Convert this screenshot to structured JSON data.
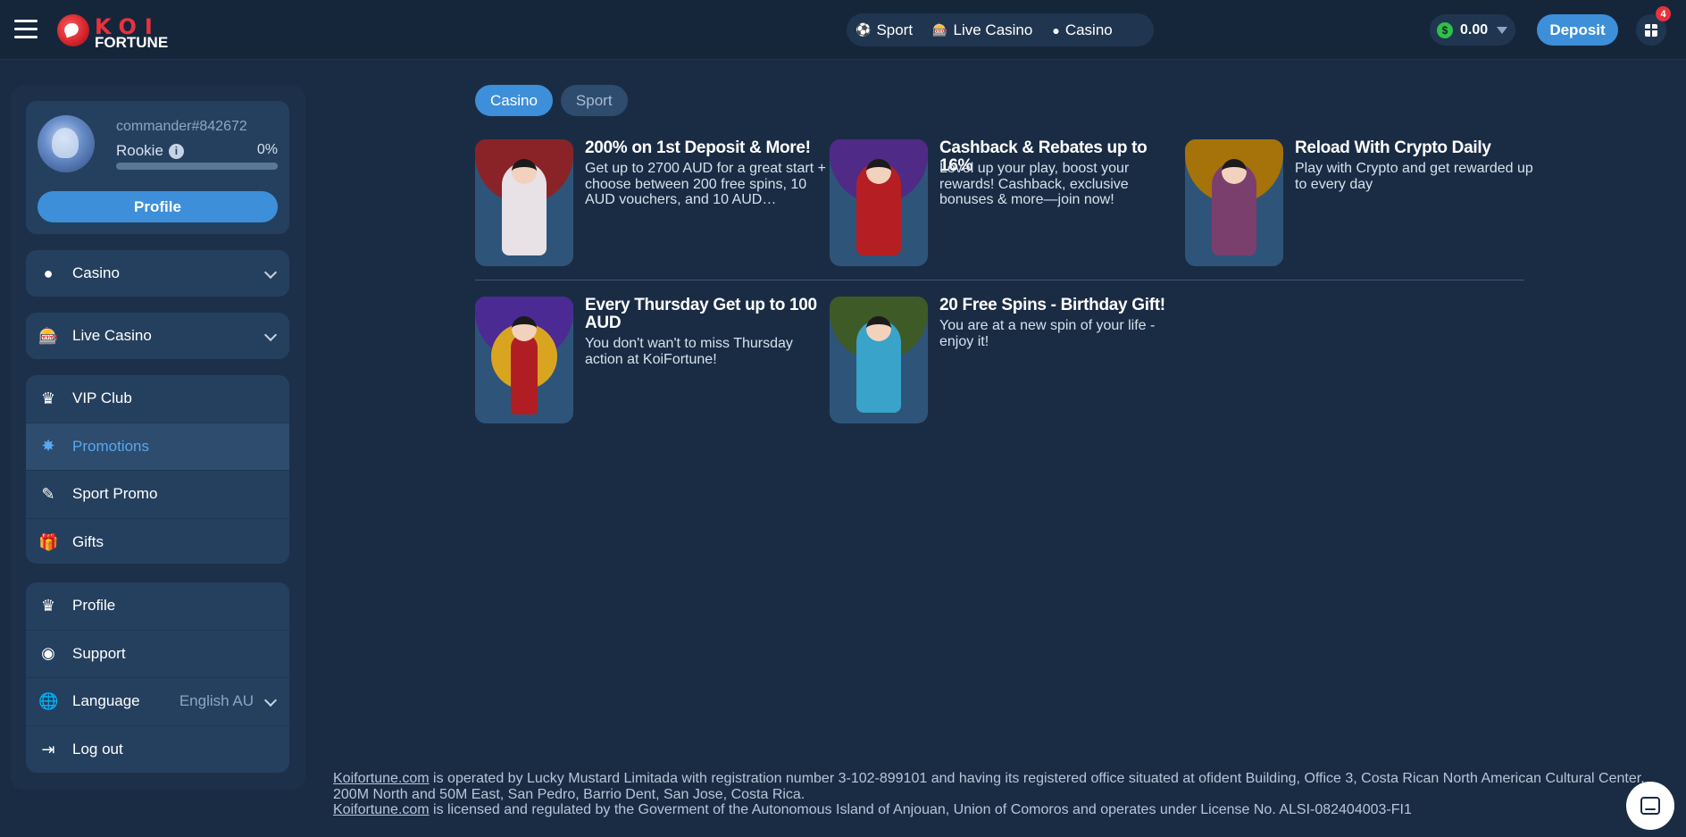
{
  "header": {
    "menu_icon": "hamburger-icon",
    "logo_top": "KOI",
    "logo_bottom": "FORTUNE",
    "nav": [
      {
        "label": "Sport",
        "icon": "soccer-ball-icon"
      },
      {
        "label": "Live Casino",
        "icon": "slot-machine-icon"
      },
      {
        "label": "Casino",
        "icon": "chip-icon"
      }
    ],
    "balance": "0.00",
    "currency_symbol": "$",
    "deposit_label": "Deposit",
    "gift_badge": "4"
  },
  "sidebar": {
    "profile": {
      "username": "commander#842672",
      "rank": "Rookie",
      "progress_pct": "0%",
      "progress_value": 0,
      "profile_button": "Profile"
    },
    "dropdowns": [
      {
        "label": "Casino",
        "icon": "chip-icon"
      },
      {
        "label": "Live Casino",
        "icon": "slot-machine-icon"
      }
    ],
    "menu": [
      {
        "label": "VIP Club",
        "icon": "crown-icon"
      },
      {
        "label": "Promotions",
        "icon": "star-burst-icon",
        "active": true
      },
      {
        "label": "Sport Promo",
        "icon": "ticket-icon"
      },
      {
        "label": "Gifts",
        "icon": "gift-icon"
      }
    ],
    "menu2": [
      {
        "label": "Profile",
        "icon": "crown-icon"
      },
      {
        "label": "Support",
        "icon": "support-icon"
      },
      {
        "label": "Language",
        "icon": "globe-icon",
        "value": "English AU"
      },
      {
        "label": "Log out",
        "icon": "logout-icon"
      }
    ]
  },
  "tabs": [
    {
      "label": "Casino",
      "active": true
    },
    {
      "label": "Sport",
      "active": false
    }
  ],
  "promotions": [
    {
      "title": "200% on 1st Deposit & More!",
      "description": "Get up to 2700 AUD for a great start + choose between 200 free spins, 10 AUD vouchers, and 10 AUD…",
      "color": "#8a2327"
    },
    {
      "title": "Cashback & Rebates up to 16%",
      "description": "Level up your play, boost your rewards! Cashback, exclusive bonuses & more—join now!",
      "color": "#4f2a86"
    },
    {
      "title": "Reload With Crypto Daily",
      "description": "Play with Crypto and get rewarded up to every day",
      "color": "#a6720a"
    },
    {
      "title": "Every Thursday Get up to 100 AUD",
      "description": "You don't wan't to miss Thursday action at KoiFortune!",
      "color": "#4c2a93"
    },
    {
      "title": "20 Free Spins - Birthday Gift!",
      "description": "You are at a new spin of your life - enjoy it!",
      "color": "#3e5a26"
    }
  ],
  "footer": {
    "link": "Koifortune.com",
    "line1": " is operated by Lucky Mustard Limitada with registration number 3-102-899101 and having its registered office situated at ofident Building, Office 3, Costa Rican North American Cultural Center, 200M North and 50M East, San Pedro, Barrio Dent, San Jose, Costa Rica.",
    "line2": " is licensed and regulated by the Goverment of the Autonomous Island of Anjouan, Union of Comoros and operates under License No. ALSI-082404003-FI1"
  },
  "chat_icon": "chat-icon"
}
